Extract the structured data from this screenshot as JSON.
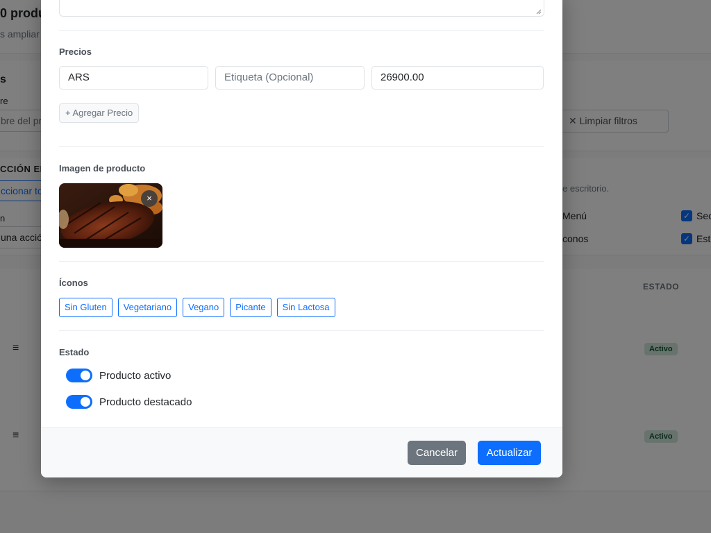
{
  "background": {
    "count_title": "0 produ",
    "subtitle": "s ampliar",
    "filters_title": "s",
    "name_label": "re",
    "name_placeholder": "bre del pro",
    "clear_filters": "✕ Limpiar filtros",
    "bulk_title": "CCIÓN EN",
    "select_all": "ccionar tod",
    "action_label": "n",
    "action_placeholder": " una acció",
    "desktop_hint": "e escritorio.",
    "col_menu": "Menú",
    "col_icons": "conos",
    "col_sec": "Sec",
    "col_est": "Est",
    "status_header": "ESTADO",
    "rows": [
      {
        "status": "Activo"
      },
      {
        "status": "Activo"
      }
    ]
  },
  "modal": {
    "prices_label": "Precios",
    "price": {
      "currency": "ARS",
      "label_placeholder": "Etiqueta (Opcional)",
      "amount": "26900.00"
    },
    "add_price_label": "+ Agregar Precio",
    "image_label": "Imagen de producto",
    "remove_image_label": "×",
    "icons_label": "Íconos",
    "icon_chips": [
      "Sin Gluten",
      "Vegetariano",
      "Vegano",
      "Picante",
      "Sin Lactosa"
    ],
    "status_label": "Estado",
    "toggles": [
      {
        "label": "Producto activo",
        "on": true
      },
      {
        "label": "Producto destacado",
        "on": true
      }
    ],
    "cancel_label": "Cancelar",
    "update_label": "Actualizar"
  },
  "colors": {
    "primary": "#0d6efd",
    "secondary": "#6c757d",
    "success_bg": "#d1e7dd"
  }
}
